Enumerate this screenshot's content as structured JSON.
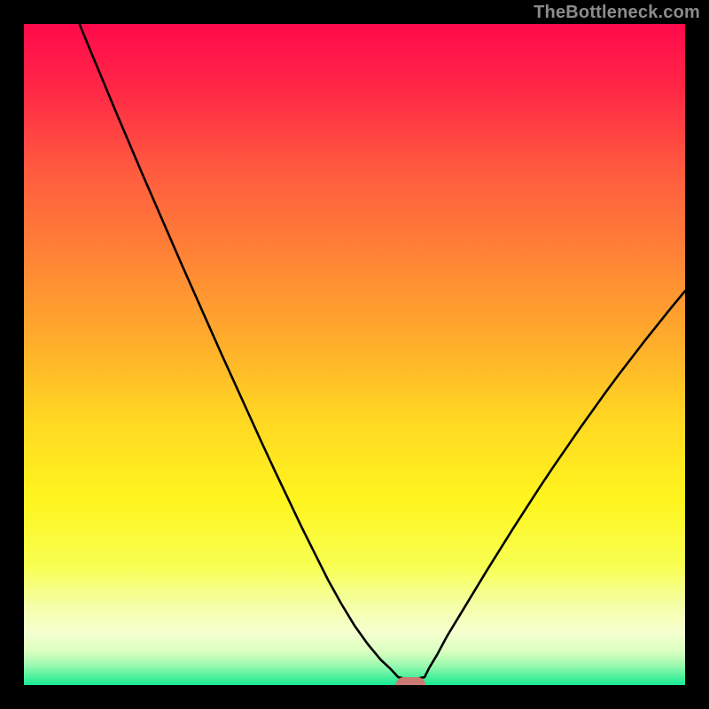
{
  "attribution": "TheBottleneck.com",
  "colors": {
    "frame": "#000000",
    "curve": "#000000",
    "marker_fill": "#cb7a73",
    "gradient_stops": [
      {
        "offset": 0.0,
        "color": "#ff0a4b"
      },
      {
        "offset": 0.1,
        "color": "#ff2846"
      },
      {
        "offset": 0.22,
        "color": "#ff5a3f"
      },
      {
        "offset": 0.35,
        "color": "#ff8336"
      },
      {
        "offset": 0.48,
        "color": "#ffad2b"
      },
      {
        "offset": 0.6,
        "color": "#ffd822"
      },
      {
        "offset": 0.72,
        "color": "#fff51e"
      },
      {
        "offset": 0.82,
        "color": "#f8ff52"
      },
      {
        "offset": 0.88,
        "color": "#f4ffa8"
      },
      {
        "offset": 0.92,
        "color": "#f6ffd0"
      },
      {
        "offset": 0.95,
        "color": "#d8ffbf"
      },
      {
        "offset": 0.97,
        "color": "#9cf9b0"
      },
      {
        "offset": 0.985,
        "color": "#57f29e"
      },
      {
        "offset": 1.0,
        "color": "#18e996"
      }
    ]
  },
  "chart_data": {
    "type": "line",
    "title": "",
    "xlabel": "",
    "ylabel": "",
    "xlim": [
      0,
      100
    ],
    "ylim": [
      0,
      100
    ],
    "marker": {
      "x": 58.5,
      "y": 0,
      "w": 4.5,
      "h": 2.4
    },
    "series": [
      {
        "name": "bottleneck-curve",
        "x": [
          8.4,
          10,
          12,
          14,
          16,
          18,
          20,
          22,
          24,
          26,
          28,
          30,
          32,
          34,
          36,
          38,
          40,
          42,
          44,
          46,
          48,
          50,
          52,
          54,
          55.5,
          56.6,
          58.5,
          60.6,
          61.3,
          62.5,
          64,
          66,
          68,
          70,
          72,
          74,
          76,
          78,
          80,
          82,
          84,
          86,
          88,
          90,
          92,
          94,
          96,
          98,
          100
        ],
        "y": [
          100.0,
          96.1,
          91.3,
          86.5,
          81.8,
          77.1,
          72.5,
          67.9,
          63.3,
          58.8,
          54.3,
          49.8,
          45.4,
          41.0,
          36.6,
          32.3,
          28.1,
          23.9,
          19.9,
          15.9,
          12.3,
          9.0,
          6.2,
          3.8,
          2.4,
          1.2,
          0.8,
          1.2,
          2.6,
          4.6,
          7.4,
          10.7,
          14.0,
          17.3,
          20.5,
          23.7,
          26.8,
          29.9,
          32.9,
          35.8,
          38.7,
          41.5,
          44.3,
          47.0,
          49.6,
          52.2,
          54.7,
          57.2,
          59.6
        ]
      }
    ]
  }
}
